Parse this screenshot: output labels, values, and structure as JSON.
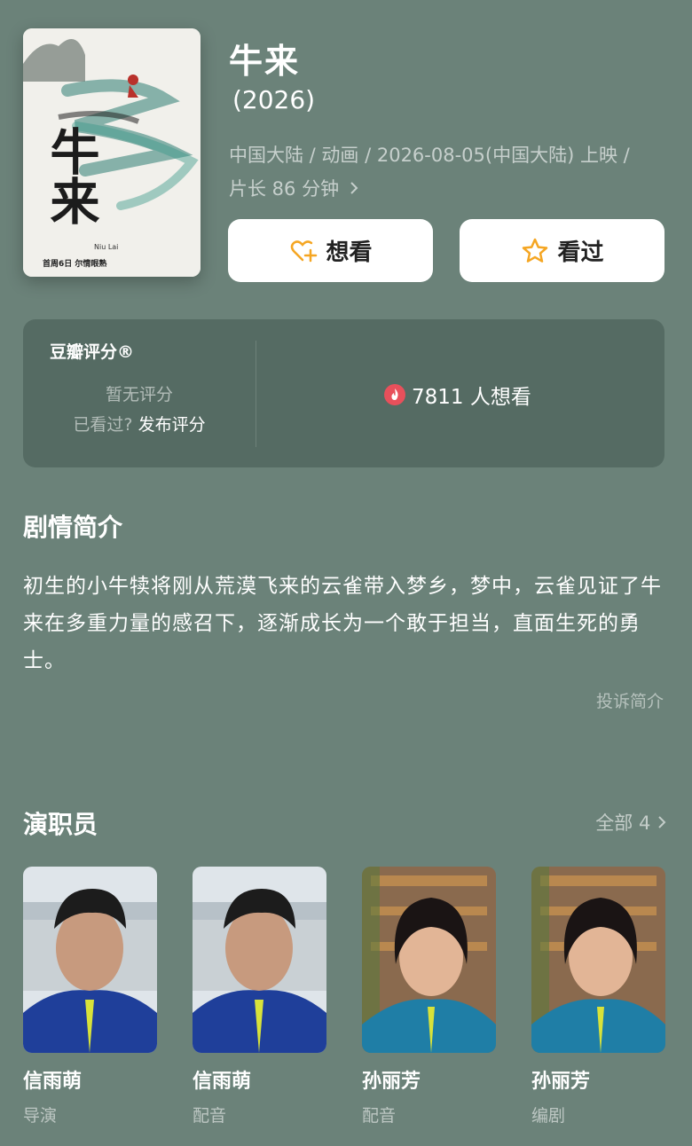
{
  "movie": {
    "title": "牛来",
    "year": "(2026)",
    "meta_line1": "中国大陆 / 动画 / 2026-08-05(中国大陆) 上映 /",
    "meta_line2": "片长 86 分钟",
    "poster_calligraphy": "牛来",
    "poster_subtitle": "Niu Lai",
    "poster_tagline": "首周6日  尔情眼熟"
  },
  "actions": {
    "wish_label": "想看",
    "seen_label": "看过",
    "wish_icon": "heart-plus-icon",
    "seen_icon": "star-outline-icon",
    "accent_color": "#f5a623"
  },
  "rating": {
    "title": "豆瓣评分®",
    "no_rating": "暂无评分",
    "seen_question": "已看过?",
    "publish_link": "发布评分",
    "want_count": "7811 人想看",
    "fire_color": "#e8505b"
  },
  "synopsis": {
    "heading": "剧情简介",
    "text": "初生的小牛犊将刚从荒漠飞来的云雀带入梦乡，梦中，云雀见证了牛来在多重力量的感召下，逐渐成长为一个敢于担当，直面生死的勇士。",
    "complain_link": "投诉简介"
  },
  "cast": {
    "heading": "演职员",
    "all_link": "全部 4",
    "members": [
      {
        "name": "信雨萌",
        "role": "导演"
      },
      {
        "name": "信雨萌",
        "role": "配音"
      },
      {
        "name": "孙丽芳",
        "role": "配音"
      },
      {
        "name": "孙丽芳",
        "role": "编剧"
      }
    ]
  },
  "colors": {
    "background": "#6b8279",
    "card": "#ffffff"
  }
}
